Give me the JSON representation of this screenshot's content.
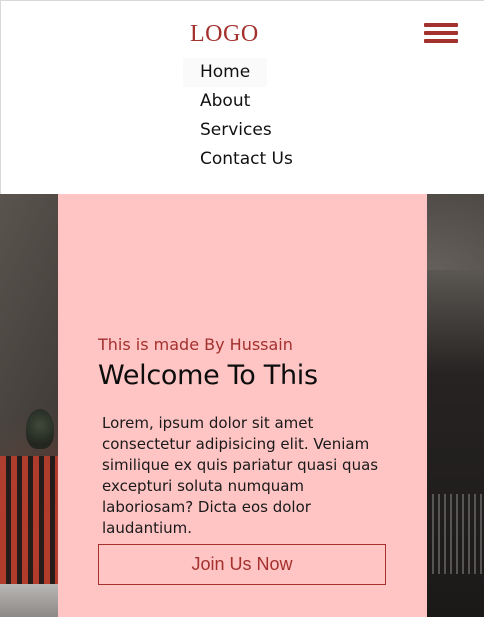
{
  "header": {
    "logo": "LOGO",
    "menu_icon": "hamburger-menu-icon",
    "brand_color": "#a3312e"
  },
  "nav": {
    "items": [
      {
        "label": "Home"
      },
      {
        "label": "About"
      },
      {
        "label": "Services"
      },
      {
        "label": "Contact Us"
      }
    ]
  },
  "hero": {
    "subtitle": "This is made By Hussain",
    "title": "Welcome To This",
    "description": "Lorem, ipsum dolor sit amet consectetur adipisicing elit. Veniam similique ex quis pariatur quasi quas excepturi soluta numquam laboriosam? Dicta eos dolor laudantium.",
    "cta_label": "Join Us Now",
    "card_color": "#ffc4c4"
  }
}
